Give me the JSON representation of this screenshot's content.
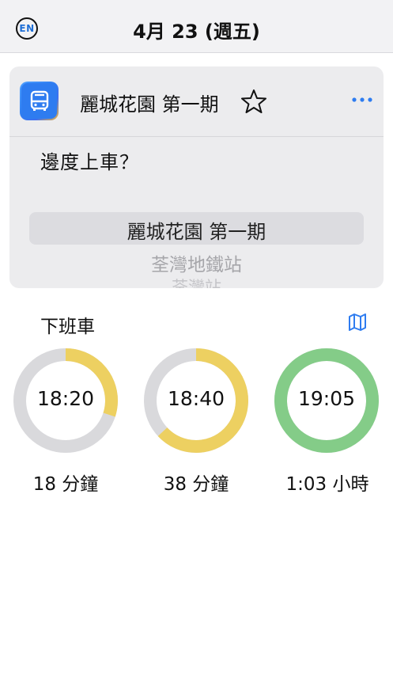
{
  "header": {
    "lang_button": "EN",
    "date": "4月 23 (週五)"
  },
  "card": {
    "stop_name": "麗城花園 第一期",
    "question": "邊度上車？",
    "picker_items": [
      "麗城花園 第一期",
      "荃灣地鐵站",
      "荃灣站"
    ]
  },
  "next_bus": {
    "title": "下班車",
    "buses": [
      {
        "time": "18:20",
        "eta": "18 分鐘",
        "progress": 0.3,
        "color": "#edd061"
      },
      {
        "time": "18:40",
        "eta": "38 分鐘",
        "progress": 0.63,
        "color": "#edd061"
      },
      {
        "time": "19:05",
        "eta": "1:03 小時",
        "progress": 1.0,
        "color": "#84cc88"
      }
    ]
  },
  "icons": {
    "bus": "bus-icon",
    "star": "star-outline-icon",
    "more": "more-horizontal-icon",
    "map": "map-icon"
  },
  "colors": {
    "ring_track": "#d9d9dc",
    "accent_blue": "#2e7cf0"
  }
}
